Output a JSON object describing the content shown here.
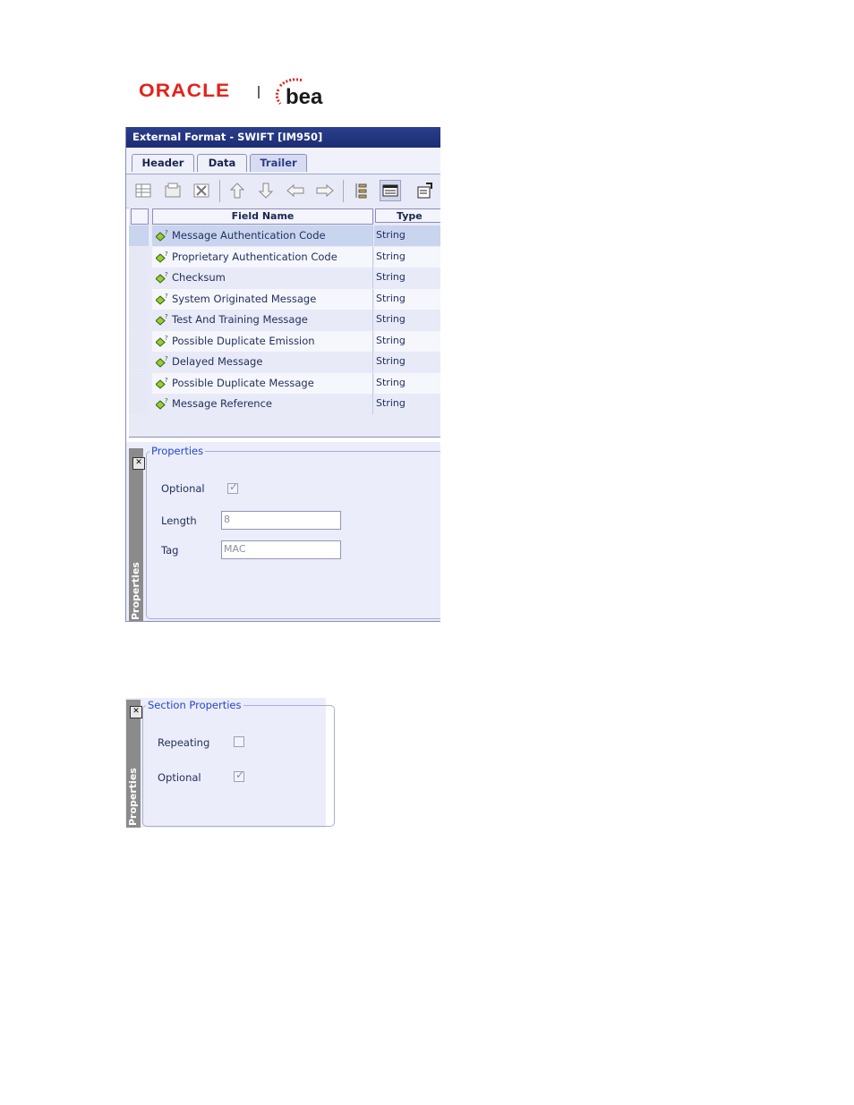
{
  "logo": {
    "oracle": "ORACLE",
    "bea": "bea",
    "oracle_color": "#e2231a",
    "bea_color": "#e2231a"
  },
  "window": {
    "title": "External Format - SWIFT [IM950]",
    "tabs": [
      {
        "label": "Header",
        "active": false
      },
      {
        "label": "Data",
        "active": false
      },
      {
        "label": "Trailer",
        "active": true
      }
    ],
    "toolbar": [
      "add-field-icon",
      "add-section-icon",
      "delete-icon",
      "move-up-icon",
      "move-down-icon",
      "move-left-icon",
      "move-right-icon",
      "tree-view-icon",
      "grid-view-icon",
      "properties-icon"
    ],
    "grid": {
      "columns": {
        "name": "Field Name",
        "type": "Type"
      },
      "rows": [
        {
          "name": "Message Authentication Code",
          "type": "String",
          "selected": true
        },
        {
          "name": "Proprietary Authentication Code",
          "type": "String"
        },
        {
          "name": "Checksum",
          "type": "String"
        },
        {
          "name": "System Originated Message",
          "type": "String"
        },
        {
          "name": "Test And Training Message",
          "type": "String"
        },
        {
          "name": "Possible Duplicate Emission",
          "type": "String"
        },
        {
          "name": "Delayed Message",
          "type": "String"
        },
        {
          "name": "Possible Duplicate Message",
          "type": "String"
        },
        {
          "name": "Message Reference",
          "type": "String"
        }
      ]
    },
    "properties": {
      "side_label": "Properties",
      "legend": "Properties",
      "optional_label": "Optional",
      "optional_checked": true,
      "length_label": "Length",
      "length_value": "8",
      "tag_label": "Tag",
      "tag_value": "MAC"
    }
  },
  "section_panel": {
    "side_label": "Properties",
    "legend": "Section Properties",
    "repeating_label": "Repeating",
    "repeating_checked": false,
    "optional_label": "Optional",
    "optional_checked": true
  },
  "colors": {
    "title_bar": "#1f3280",
    "selection": "#c9d4ee",
    "legend_text": "#2148c9"
  }
}
